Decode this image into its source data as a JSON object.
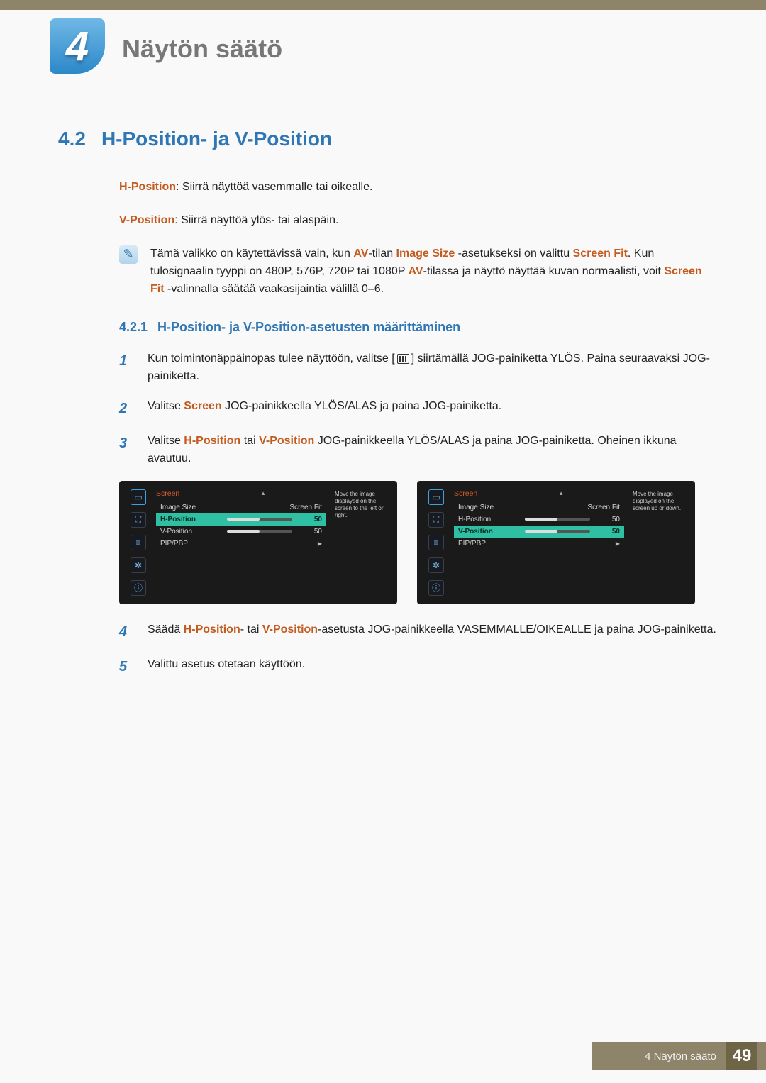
{
  "header": {
    "chapter_number": "4",
    "chapter_title": "Näytön säätö"
  },
  "section": {
    "number": "4.2",
    "title": "H-Position- ja V-Position"
  },
  "intro": {
    "h_label": "H-Position",
    "h_desc": ": Siirrä näyttöä vasemmalle tai oikealle.",
    "v_label": "V-Position",
    "v_desc": ": Siirrä näyttöä ylös- tai alaspäin."
  },
  "note": {
    "t1": "Tämä valikko on käytettävissä vain, kun ",
    "av": "AV",
    "t2": "-tilan ",
    "is": "Image Size",
    "t3": " -asetukseksi on valittu ",
    "sf": "Screen Fit",
    "t4": ". Kun tulosignaalin tyyppi on 480P, 576P, 720P tai 1080P ",
    "t5": "-tilassa ja näyttö näyttää kuvan normaalisti, voit ",
    "t6": " -valinnalla säätää vaakasijaintia välillä 0–6."
  },
  "subsection": {
    "number": "4.2.1",
    "title": "H-Position- ja V-Position-asetusten määrittäminen"
  },
  "steps": {
    "s1a": "Kun toimintonäppäinopas tulee näyttöön, valitse [",
    "s1b": "] siirtämällä JOG-painiketta YLÖS. Paina seuraavaksi JOG-painiketta.",
    "s2a": "Valitse ",
    "s2_scr": "Screen",
    "s2b": " JOG-painikkeella YLÖS/ALAS ja paina JOG-painiketta.",
    "s3a": "Valitse ",
    "s3_h": "H-Position",
    "s3_or": " tai ",
    "s3_v": "V-Position",
    "s3b": " JOG-painikkeella YLÖS/ALAS ja paina JOG-painiketta. Oheinen ikkuna avautuu.",
    "s4a": "Säädä ",
    "s4_h": "H-Position",
    "s4_or": "- tai ",
    "s4_v": "V-Position",
    "s4b": "-asetusta JOG-painikkeella VASEMMALLE/OIKEALLE ja paina JOG-painiketta.",
    "s5": "Valittu asetus otetaan käyttöön."
  },
  "osd": {
    "title": "Screen",
    "image_size": "Image Size",
    "screen_fit": "Screen Fit",
    "h_position": "H-Position",
    "v_position": "V-Position",
    "pip_pbp": "PIP/PBP",
    "val50": "50",
    "desc_h": "Move the image displayed on the screen to the left or right.",
    "desc_v": "Move the image displayed on the screen up or down."
  },
  "step_numbers": {
    "n1": "1",
    "n2": "2",
    "n3": "3",
    "n4": "4",
    "n5": "5"
  },
  "footer": {
    "label": "4 Näytön säätö",
    "page": "49"
  }
}
